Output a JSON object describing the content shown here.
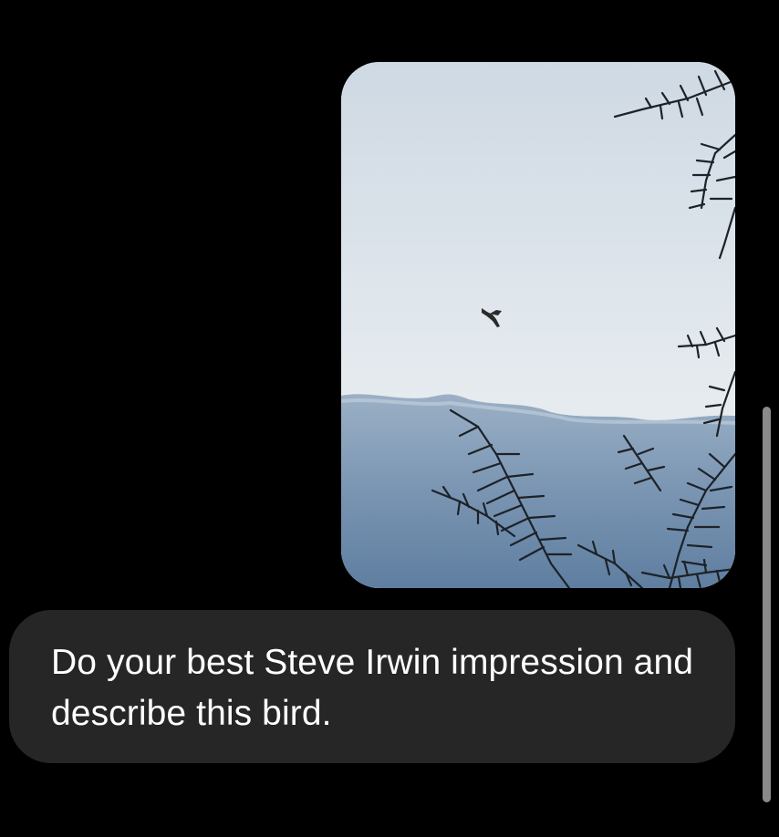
{
  "conversation": {
    "messages": [
      {
        "role": "user",
        "type": "image",
        "content": "photo-bird-in-sky"
      },
      {
        "role": "user",
        "type": "text",
        "text": "Do your best Steve Irwin impression and describe this bird."
      }
    ]
  },
  "colors": {
    "background": "#000000",
    "bubble": "#262626",
    "text": "#ffffff",
    "scrollbar": "#8a8a8a"
  },
  "scroll": {
    "position_fraction": 1.0
  }
}
